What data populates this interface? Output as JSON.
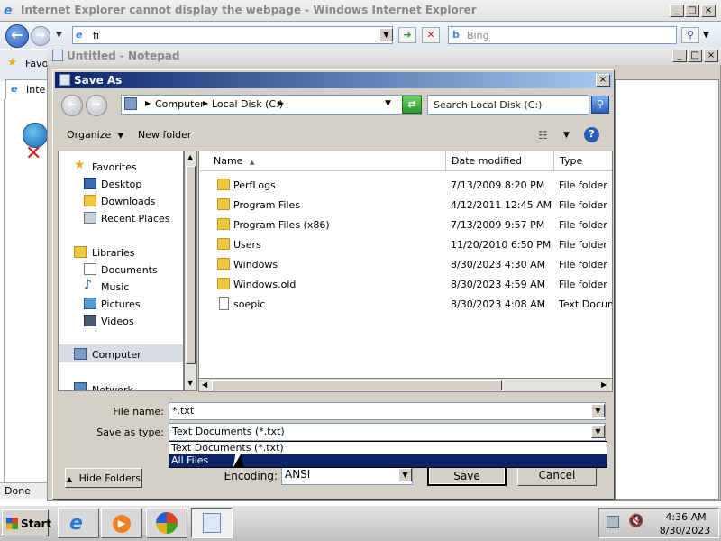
{
  "ie": {
    "title": "Internet Explorer cannot display the webpage - Windows Internet Explorer",
    "address": "fi",
    "search_placeholder": "Bing",
    "favorites_partial": "Favo",
    "tab_partial": "Inte",
    "status": "Done"
  },
  "notepad": {
    "title": "Untitled - Notepad"
  },
  "dialog": {
    "title": "Save As",
    "breadcrumb": [
      "Computer",
      "Local Disk (C:)"
    ],
    "search_placeholder": "Search Local Disk (C:)",
    "toolbar": {
      "organize": "Organize",
      "new_folder": "New folder"
    },
    "nav": {
      "favorites": "Favorites",
      "favorites_items": [
        "Desktop",
        "Downloads",
        "Recent Places"
      ],
      "libraries": "Libraries",
      "libraries_items": [
        "Documents",
        "Music",
        "Pictures",
        "Videos"
      ],
      "computer": "Computer",
      "network": "Network"
    },
    "columns": [
      "Name",
      "Date modified",
      "Type"
    ],
    "files": [
      {
        "name": "PerfLogs",
        "date": "7/13/2009 8:20 PM",
        "type": "File folder",
        "icon": "folder-icon"
      },
      {
        "name": "Program Files",
        "date": "4/12/2011 12:45 AM",
        "type": "File folder",
        "icon": "folder-icon"
      },
      {
        "name": "Program Files (x86)",
        "date": "7/13/2009 9:57 PM",
        "type": "File folder",
        "icon": "folder-icon"
      },
      {
        "name": "Users",
        "date": "11/20/2010 6:50 PM",
        "type": "File folder",
        "icon": "folder-icon"
      },
      {
        "name": "Windows",
        "date": "8/30/2023 4:30 AM",
        "type": "File folder",
        "icon": "folder-icon"
      },
      {
        "name": "Windows.old",
        "date": "8/30/2023 4:59 AM",
        "type": "File folder",
        "icon": "folder-icon"
      },
      {
        "name": "soepic",
        "date": "8/30/2023 4:08 AM",
        "type": "Text Docume",
        "icon": "text-document-icon"
      }
    ],
    "file_name_label": "File name:",
    "file_name_value": "*.txt",
    "save_type_label": "Save as type:",
    "save_type_value": "Text Documents (*.txt)",
    "save_type_options": [
      "Text Documents (*.txt)",
      "All Files"
    ],
    "encoding_label": "Encoding:",
    "encoding_value": "ANSI",
    "hide_folders": "Hide Folders",
    "save": "Save",
    "cancel": "Cancel"
  },
  "taskbar": {
    "start": "Start",
    "time": "4:36 AM",
    "date": "8/30/2023"
  },
  "colors": {
    "dialog_title": "#0a246a",
    "selected": "#0a246a",
    "folder": "#f0c840"
  }
}
